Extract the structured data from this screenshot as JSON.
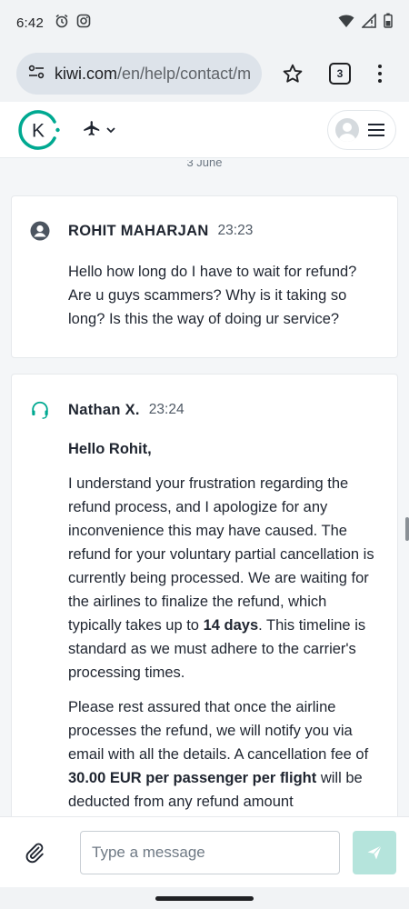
{
  "status_bar": {
    "time": "6:42",
    "left_icons": [
      "alarm-icon",
      "instagram-icon"
    ],
    "right_icons": [
      "wifi-icon",
      "signal-icon",
      "battery-icon"
    ]
  },
  "browser": {
    "url_domain": "kiwi.com",
    "url_path": "/en/help/contact/me",
    "tab_count": "3",
    "icons": [
      "site-settings-icon",
      "star-icon",
      "tabs-icon",
      "more-vert-icon"
    ]
  },
  "site_header": {
    "logo_letter": "K",
    "travel_icon": "plane-icon",
    "account_icons": [
      "avatar-icon",
      "hamburger-icon"
    ],
    "accent_color": "#00a991"
  },
  "chat": {
    "date_separator": "3 June",
    "messages": [
      {
        "sender": "ROHIT MAHARJAN",
        "time": "23:23",
        "icon": "user-circle-icon",
        "paragraphs": [
          "Hello how long do I have to wait for refund? Are u guys scammers? Why is it taking so long? Is this the way of doing ur service?"
        ]
      },
      {
        "sender": "Nathan X.",
        "time": "23:24",
        "icon": "headset-icon",
        "greeting": "Hello Rohit,",
        "p1_a": "I understand your frustration regarding the refund process, and I apologize for any inconvenience this may have caused. The refund for your voluntary partial cancellation is currently being processed. We are waiting for the airlines to finalize the refund, which typically takes up to ",
        "p1_b": "14 days",
        "p1_c": ". This timeline is standard as we must adhere to the carrier's processing times.",
        "p2_a": "Please rest assured that once the airline processes the refund, we will notify you via email with all the details. A cancellation fee of ",
        "p2_b": "30.00 EUR per passenger per flight",
        "p2_c": " will be deducted from any refund amount"
      }
    ]
  },
  "composer": {
    "placeholder": "Type a message",
    "attach_icon": "paperclip-icon",
    "send_icon": "send-icon",
    "send_color": "#b5e4dc"
  }
}
